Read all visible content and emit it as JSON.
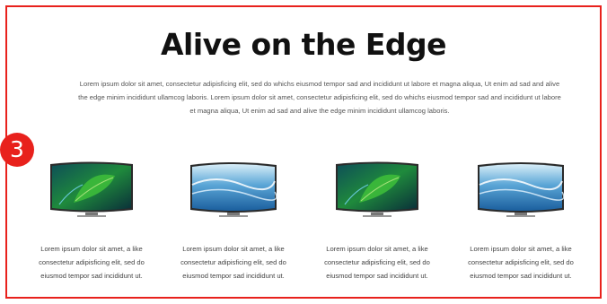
{
  "section": {
    "number": "3",
    "title": "Alive on the Edge",
    "intro": "Lorem ipsum dolor sit amet, consectetur adipisficing elit, sed do whichs eiusmod tempor sad and incididunt ut labore et magna aliqua, Ut enim ad sad and alive the edge minim incididunt ullamcog laboris. Lorem ipsum dolor sit amet, consectetur adipisficing elit, sed do whichs eiusmod tempor sad and incididunt ut labore et magna aliqua, Ut enim ad sad and alive the edge minim incididunt ullamcog laboris."
  },
  "products": [
    {
      "caption": "Lorem ipsum dolor sit amet, a like consectetur adipisficing elit, sed do eiusmod tempor sad incididunt ut.",
      "screen": "green-leaf"
    },
    {
      "caption": "Lorem ipsum dolor sit amet, a like consectetur adipisficing elit, sed do eiusmod tempor sad incididunt ut.",
      "screen": "ocean-wave"
    },
    {
      "caption": "Lorem ipsum dolor sit amet, a like consectetur adipisficing elit, sed do eiusmod tempor sad incididunt ut.",
      "screen": "green-leaf"
    },
    {
      "caption": "Lorem ipsum dolor sit amet, a like consectetur adipisficing elit, sed do eiusmod tempor sad incididunt ut.",
      "screen": "ocean-wave"
    }
  ],
  "colors": {
    "accent": "#e8211c",
    "title": "#111111",
    "body_text": "#555555"
  }
}
